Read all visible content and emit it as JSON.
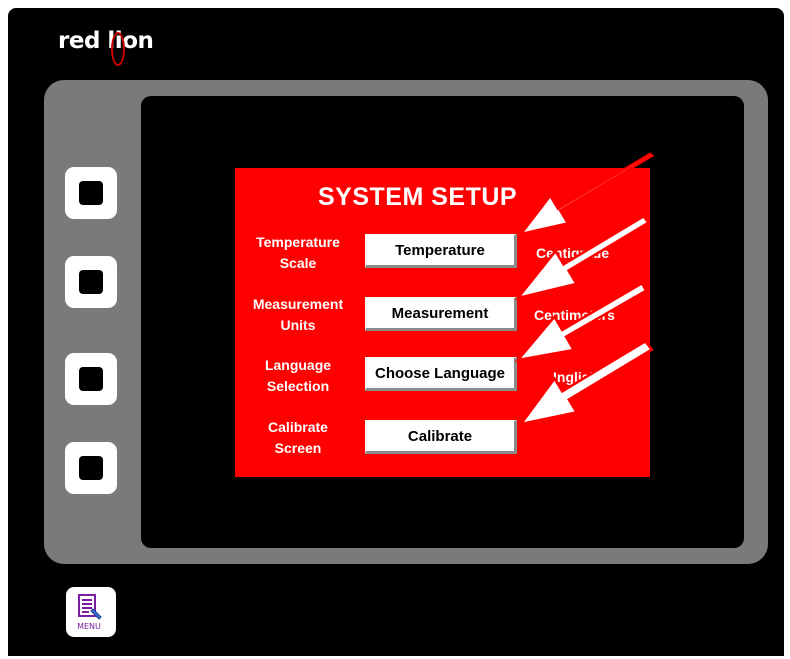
{
  "brand": {
    "logo_text_a": "red l",
    "logo_text_b": "i",
    "logo_text_c": "on"
  },
  "screen": {
    "title": "SYSTEM SETUP",
    "rows": [
      {
        "label_line1": "Temperature",
        "label_line2": "Scale",
        "button": "Temperature",
        "value": "Centigrade"
      },
      {
        "label_line1": "Measurement",
        "label_line2": "Units",
        "button": "Measurement",
        "value": "Centimeters"
      },
      {
        "label_line1": "Language",
        "label_line2": "Selection",
        "button": "Choose Language",
        "value": "Inglish"
      },
      {
        "label_line1": "Calibrate",
        "label_line2": "Screen",
        "button": "Calibrate",
        "value": ""
      }
    ]
  },
  "menu_button": {
    "label": "MENU",
    "icon": "menu-document-icon"
  },
  "side_keys": [
    {
      "icon": "soft-key-icon"
    },
    {
      "icon": "soft-key-icon"
    },
    {
      "icon": "soft-key-icon"
    },
    {
      "icon": "soft-key-icon"
    }
  ],
  "colors": {
    "panel": "#ff0000",
    "bezel": "#7a7a7a",
    "device": "#000000",
    "arrow_stroke": "#ff0000",
    "arrow_fill": "#ffffff",
    "menu_icon": "#7b1fa2"
  }
}
